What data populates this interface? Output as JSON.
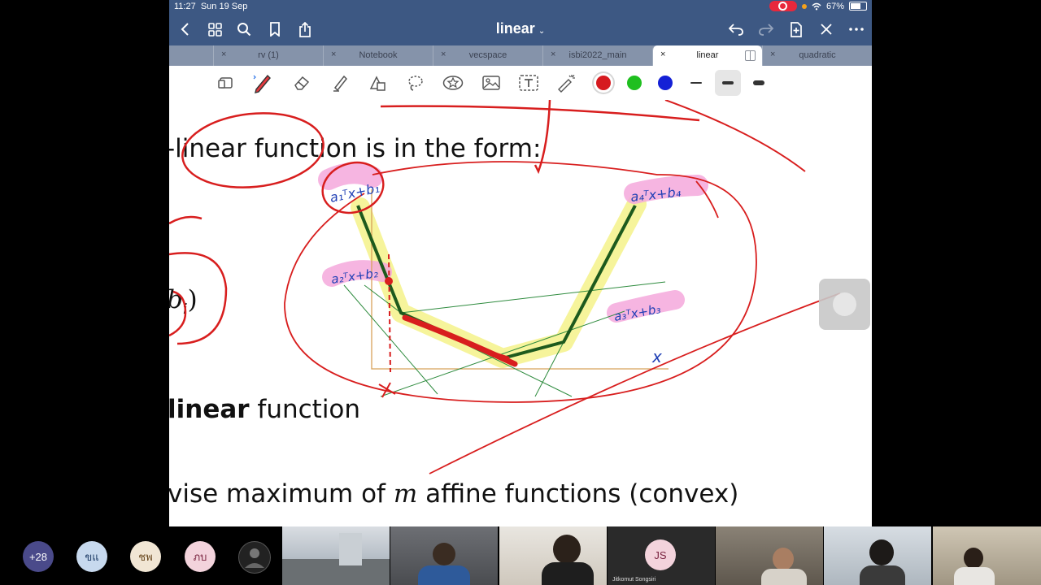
{
  "status": {
    "time": "11:27",
    "date": "Sun 19 Sep",
    "battery": "67%"
  },
  "nav": {
    "title": "linear",
    "title_icon": "chevron-down-icon"
  },
  "tabs": [
    {
      "label": "rv (1)",
      "active": false
    },
    {
      "label": "Notebook",
      "active": false
    },
    {
      "label": "vecspace",
      "active": false
    },
    {
      "label": "isbi2022_main",
      "active": false
    },
    {
      "label": "linear",
      "active": true
    },
    {
      "label": "quadratic",
      "active": false
    }
  ],
  "tab_close": "×",
  "toolbar": {
    "colors": [
      "#d61a1f",
      "#1fbf1f",
      "#1420d6"
    ],
    "selected_color": "#d61a1f"
  },
  "page": {
    "line1": "-linear function is in the form:",
    "line_b": "b",
    "line_b_sub": "i",
    "line_b_paren": ")",
    "line2_bold": "linear",
    "line2_rest": " function",
    "line3_pre": "vise maximum of ",
    "line3_m": "m",
    "line3_post": " affine functions (convex)"
  },
  "handwriting": {
    "a1": "a₁ᵀx+b₁",
    "a2": "a₂ᵀx+b₂",
    "a3": "a₃ᵀx+b₃",
    "a4": "a₄ᵀx+b₄",
    "x": "x"
  },
  "zoom": {
    "avatars": [
      {
        "label": "+28",
        "bg": "#4a4a8a",
        "fg": "#ffffff"
      },
      {
        "label": "ขแ",
        "bg": "#c7d9ee",
        "fg": "#1d3b66"
      },
      {
        "label": "ชพ",
        "bg": "#f1e6d4",
        "fg": "#6a4a20"
      },
      {
        "label": "ภบ",
        "bg": "#f3d3dc",
        "fg": "#7a2440"
      }
    ],
    "js_initials": "JS",
    "js_name": "Jitkomut Songsiri"
  }
}
